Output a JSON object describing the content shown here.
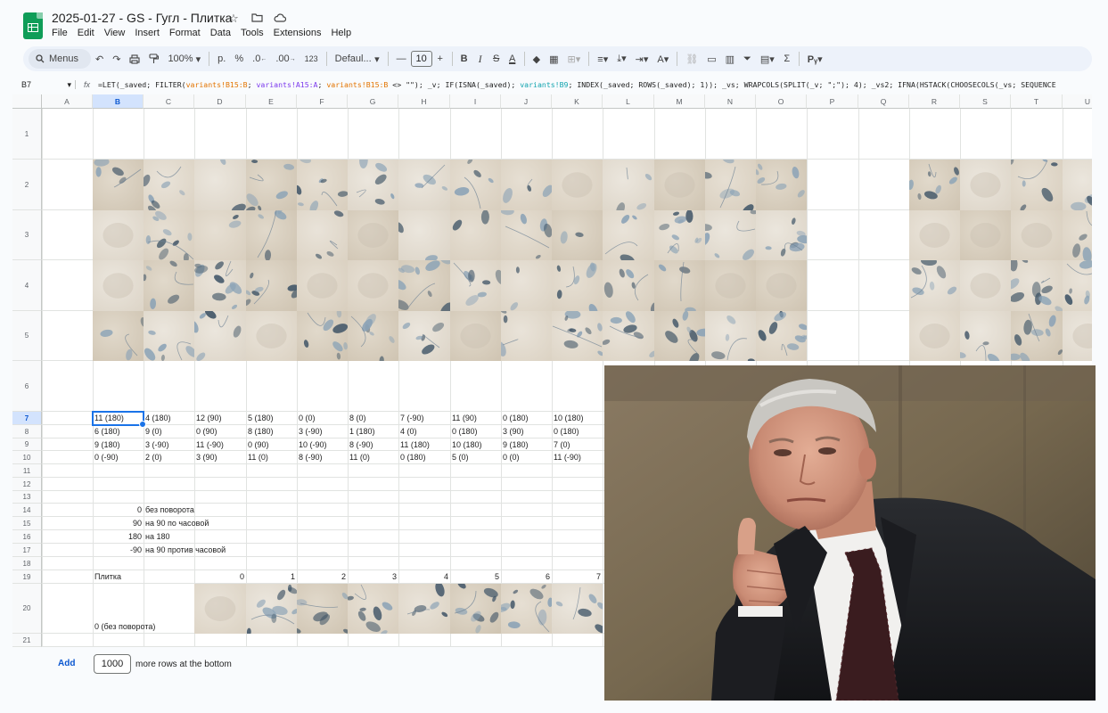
{
  "window": {
    "title": "2025-01-27 - GS - Гугл - Плитка",
    "icons": [
      "star-icon",
      "folder-move-icon",
      "cloud-status-icon"
    ]
  },
  "menu": [
    "File",
    "Edit",
    "View",
    "Insert",
    "Format",
    "Data",
    "Tools",
    "Extensions",
    "Help"
  ],
  "toolbar": {
    "search_label": "Menus",
    "zoom": "100%",
    "currency": "р.",
    "percent": "%",
    "dec_decrease": ".0",
    "dec_increase": ".00",
    "number_format": "123",
    "font": "Defaul...",
    "font_size": "10"
  },
  "formula_bar": {
    "cell_ref": "B7",
    "fx": "fx",
    "parts": [
      {
        "t": "=LET(_saved; FILTER(",
        "c": ""
      },
      {
        "t": "variants!B15:B",
        "c": "f-orange"
      },
      {
        "t": "; ",
        "c": ""
      },
      {
        "t": "variants!A15:A",
        "c": "f-purple"
      },
      {
        "t": "; ",
        "c": ""
      },
      {
        "t": "variants!B15:B",
        "c": "f-orange"
      },
      {
        "t": " <> \"\"); _v; IF(ISNA(_saved); ",
        "c": ""
      },
      {
        "t": "variants!B9",
        "c": "f-teal"
      },
      {
        "t": "; INDEX(_saved; ROWS(_saved); 1)); _vs; WRAPCOLS(SPLIT(_v; \";\"); 4); _vs2; IFNA(HSTACK(CHOOSECOLS(_vs; SEQUENCE",
        "c": ""
      }
    ]
  },
  "grid": {
    "columns": [
      "A",
      "B",
      "C",
      "D",
      "E",
      "F",
      "G",
      "H",
      "I",
      "J",
      "K",
      "L",
      "M",
      "N",
      "O",
      "P",
      "Q",
      "R",
      "S",
      "T",
      "U"
    ],
    "rows": [
      "1",
      "2",
      "3",
      "4",
      "5",
      "6",
      "7",
      "8",
      "9",
      "10",
      "11",
      "12",
      "13",
      "14",
      "15",
      "16",
      "17",
      "18",
      "19",
      "20",
      "21"
    ],
    "selected_cell": "B7",
    "values_table": [
      [
        "11 (180)",
        "4 (180)",
        "12 (90)",
        "5 (180)",
        "0 (0)",
        "8 (0)",
        "7 (-90)",
        "11 (90)",
        "0 (180)",
        "10 (180)"
      ],
      [
        "6 (180)",
        "9 (0)",
        "0 (90)",
        "8 (180)",
        "3 (-90)",
        "1 (180)",
        "4 (0)",
        "0 (180)",
        "3 (90)",
        "0 (180)"
      ],
      [
        "9 (180)",
        "3 (-90)",
        "11 (-90)",
        "0 (90)",
        "10 (-90)",
        "8 (-90)",
        "11 (180)",
        "10 (180)",
        "9 (180)",
        "7 (0)"
      ],
      [
        "0 (-90)",
        "2 (0)",
        "3 (90)",
        "11 (0)",
        "8 (-90)",
        "11 (0)",
        "0 (180)",
        "5 (0)",
        "0 (0)",
        "11 (-90)"
      ]
    ],
    "legend": [
      {
        "value": "0",
        "label": "без поворота"
      },
      {
        "value": "90",
        "label": "на 90 по часовой"
      },
      {
        "value": "180",
        "label": "на 180"
      },
      {
        "value": "-90",
        "label": "на 90 против часовой"
      }
    ],
    "tile_header_label": "Плитка",
    "tile_numbers": [
      "0",
      "1",
      "2",
      "3",
      "4",
      "5",
      "6",
      "7"
    ],
    "row20_label": "0 (без поворота)"
  },
  "footer": {
    "add_label": "Add",
    "rows_value": "1000",
    "rows_suffix": "more rows at the bottom"
  },
  "colors": {
    "accent": "#1a73e8",
    "tile_bg": "#e4ddd1",
    "leaf_dark": "#3f5466",
    "leaf_light": "#8aa2b6"
  }
}
